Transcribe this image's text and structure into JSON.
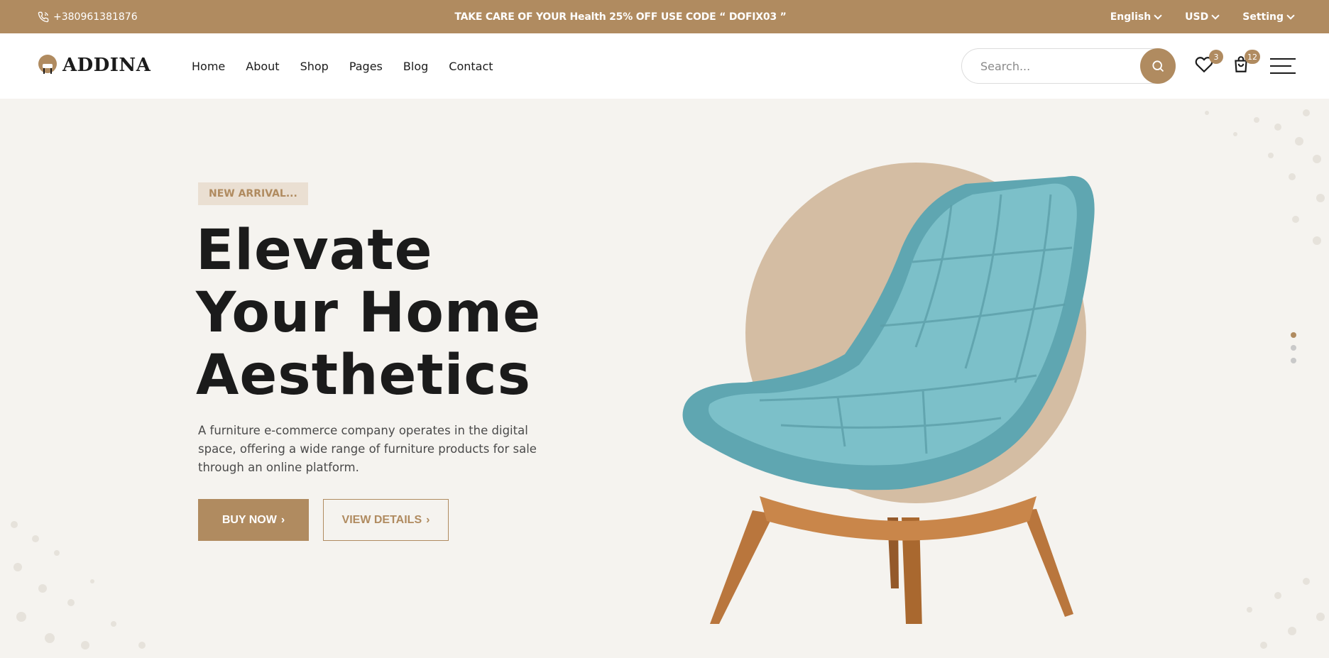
{
  "topbar": {
    "phone": "+380961381876",
    "promo": "TAKE CARE OF YOUR Health 25% OFF USE CODE “ DOFIX03 ”",
    "language": "English",
    "currency": "USD",
    "setting": "Setting"
  },
  "header": {
    "logo_text": "ADDINA",
    "nav": [
      "Home",
      "About",
      "Shop",
      "Pages",
      "Blog",
      "Contact"
    ],
    "search_placeholder": "Search...",
    "wishlist_count": "3",
    "cart_count": "12"
  },
  "hero": {
    "tag": "NEW ARRIVAL...",
    "headline": [
      "Elevate",
      "Your Home",
      "Aesthetics"
    ],
    "description": "A furniture e-commerce company operates in the digital space, offering a wide range of furniture products for sale through an online platform.",
    "buy_label": "BUY NOW",
    "view_label": "VIEW DETAILS",
    "active_slide": 1,
    "slide_count": 3
  },
  "colors": {
    "accent": "#b08b60",
    "background": "#f5f3ef",
    "chair": "#6fb3bd",
    "wood": "#b9763d"
  }
}
